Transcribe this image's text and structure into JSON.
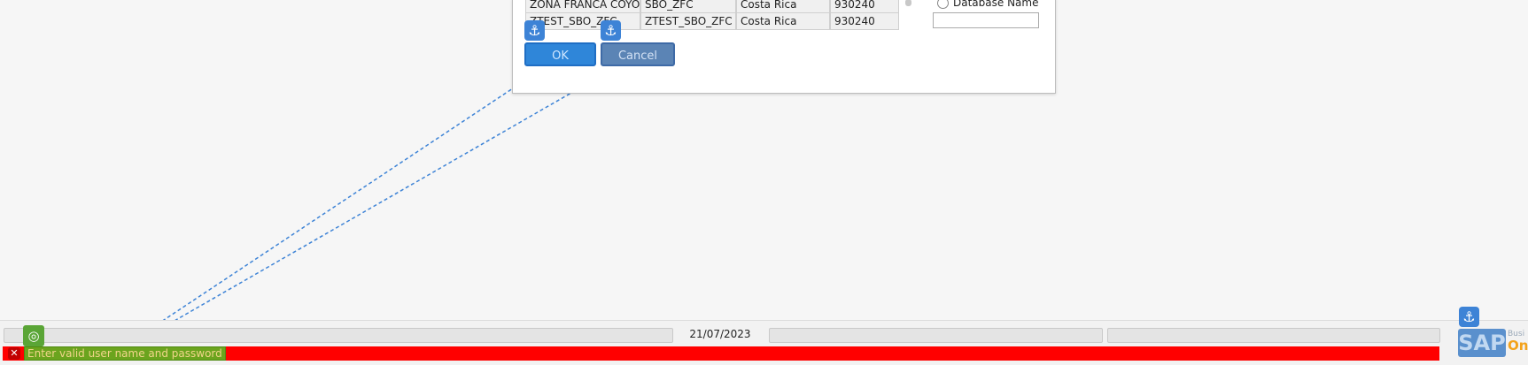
{
  "dialog": {
    "rows": [
      [
        "ZONA FRANCA COYOL",
        "SBO_ZFC",
        "Costa Rica",
        "930240"
      ],
      [
        "ZTEST_SBO_ZFC",
        "ZTEST_SBO_ZFC",
        "Costa Rica",
        "930240"
      ]
    ],
    "radio_label": "Database Name",
    "ok_label": "OK",
    "cancel_label": "Cancel"
  },
  "statusbar": {
    "date": "21/07/2023",
    "message": "Enter valid user name and password"
  },
  "branding": {
    "logo_text": "SAP",
    "tagline_top": "Busi",
    "tagline_bottom": "On"
  },
  "icons": {
    "anchor": "anchor-icon",
    "error": "error-icon",
    "target": "target-icon"
  },
  "colors": {
    "message_bar": "#ff0000",
    "ok_button": "#2f86d9",
    "cancel_button": "#5b84b5",
    "highlight": "#6ba41e",
    "connector": "#3d83d6"
  }
}
